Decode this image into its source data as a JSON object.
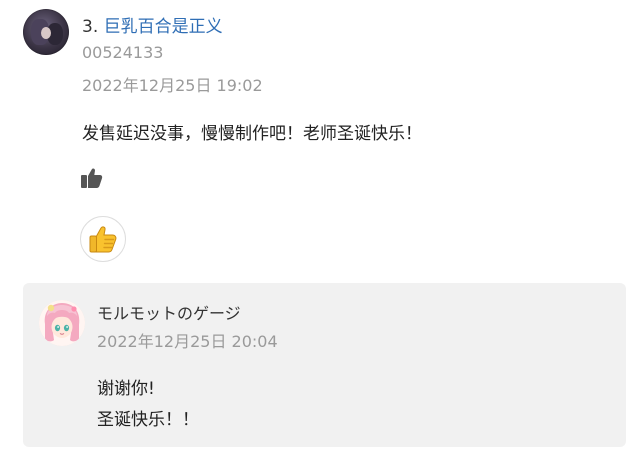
{
  "comment": {
    "rank": "3.",
    "author": "巨乳百合是正义",
    "uid": "00524133",
    "timestamp": "2022年12月25日 19:02",
    "message": "发售延迟没事，慢慢制作吧！老师圣诞快乐！",
    "icons": {
      "like": "thumbs-up-icon",
      "reaction": "thumbs-up-emoji-icon"
    }
  },
  "reply": {
    "author": "モルモットのゲージ",
    "timestamp": "2022年12月25日 20:04",
    "lines": [
      "谢谢你!",
      "圣诞快乐！！"
    ]
  },
  "colors": {
    "link": "#2f6eb5",
    "muted": "#9a9a9a",
    "reply_bg": "#f1f1f1"
  }
}
